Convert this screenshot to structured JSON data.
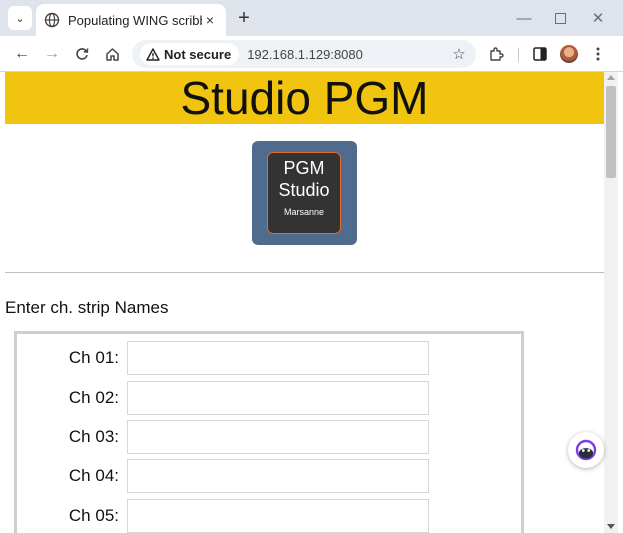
{
  "browser": {
    "tab_title": "Populating WING scribble",
    "tab_close": "×",
    "new_tab": "+",
    "security_label": "Not secure",
    "url": "192.168.1.129:8080"
  },
  "page": {
    "banner_title": "Studio PGM",
    "logo": {
      "line1": "PGM",
      "line2": "Studio",
      "line3": "Marsanne"
    },
    "heading": "Enter ch. strip Names",
    "channels": [
      {
        "label": "Ch 01:",
        "value": ""
      },
      {
        "label": "Ch 02:",
        "value": ""
      },
      {
        "label": "Ch 03:",
        "value": ""
      },
      {
        "label": "Ch 04:",
        "value": ""
      },
      {
        "label": "Ch 05:",
        "value": ""
      }
    ]
  },
  "colors": {
    "banner": "#f1c40f",
    "logo_card": "#4f6b8d",
    "logo_inner": "#333333",
    "logo_border": "#e86a2a"
  },
  "icons": [
    "tab-search-icon",
    "globe-icon",
    "close-icon",
    "plus-icon",
    "minimize-icon",
    "maximize-icon",
    "window-close-icon",
    "back-arrow-icon",
    "forward-arrow-icon",
    "reload-icon",
    "home-icon",
    "warning-icon",
    "star-icon",
    "extensions-icon",
    "side-panel-icon",
    "menu-kebab-icon",
    "assistant-icon"
  ]
}
